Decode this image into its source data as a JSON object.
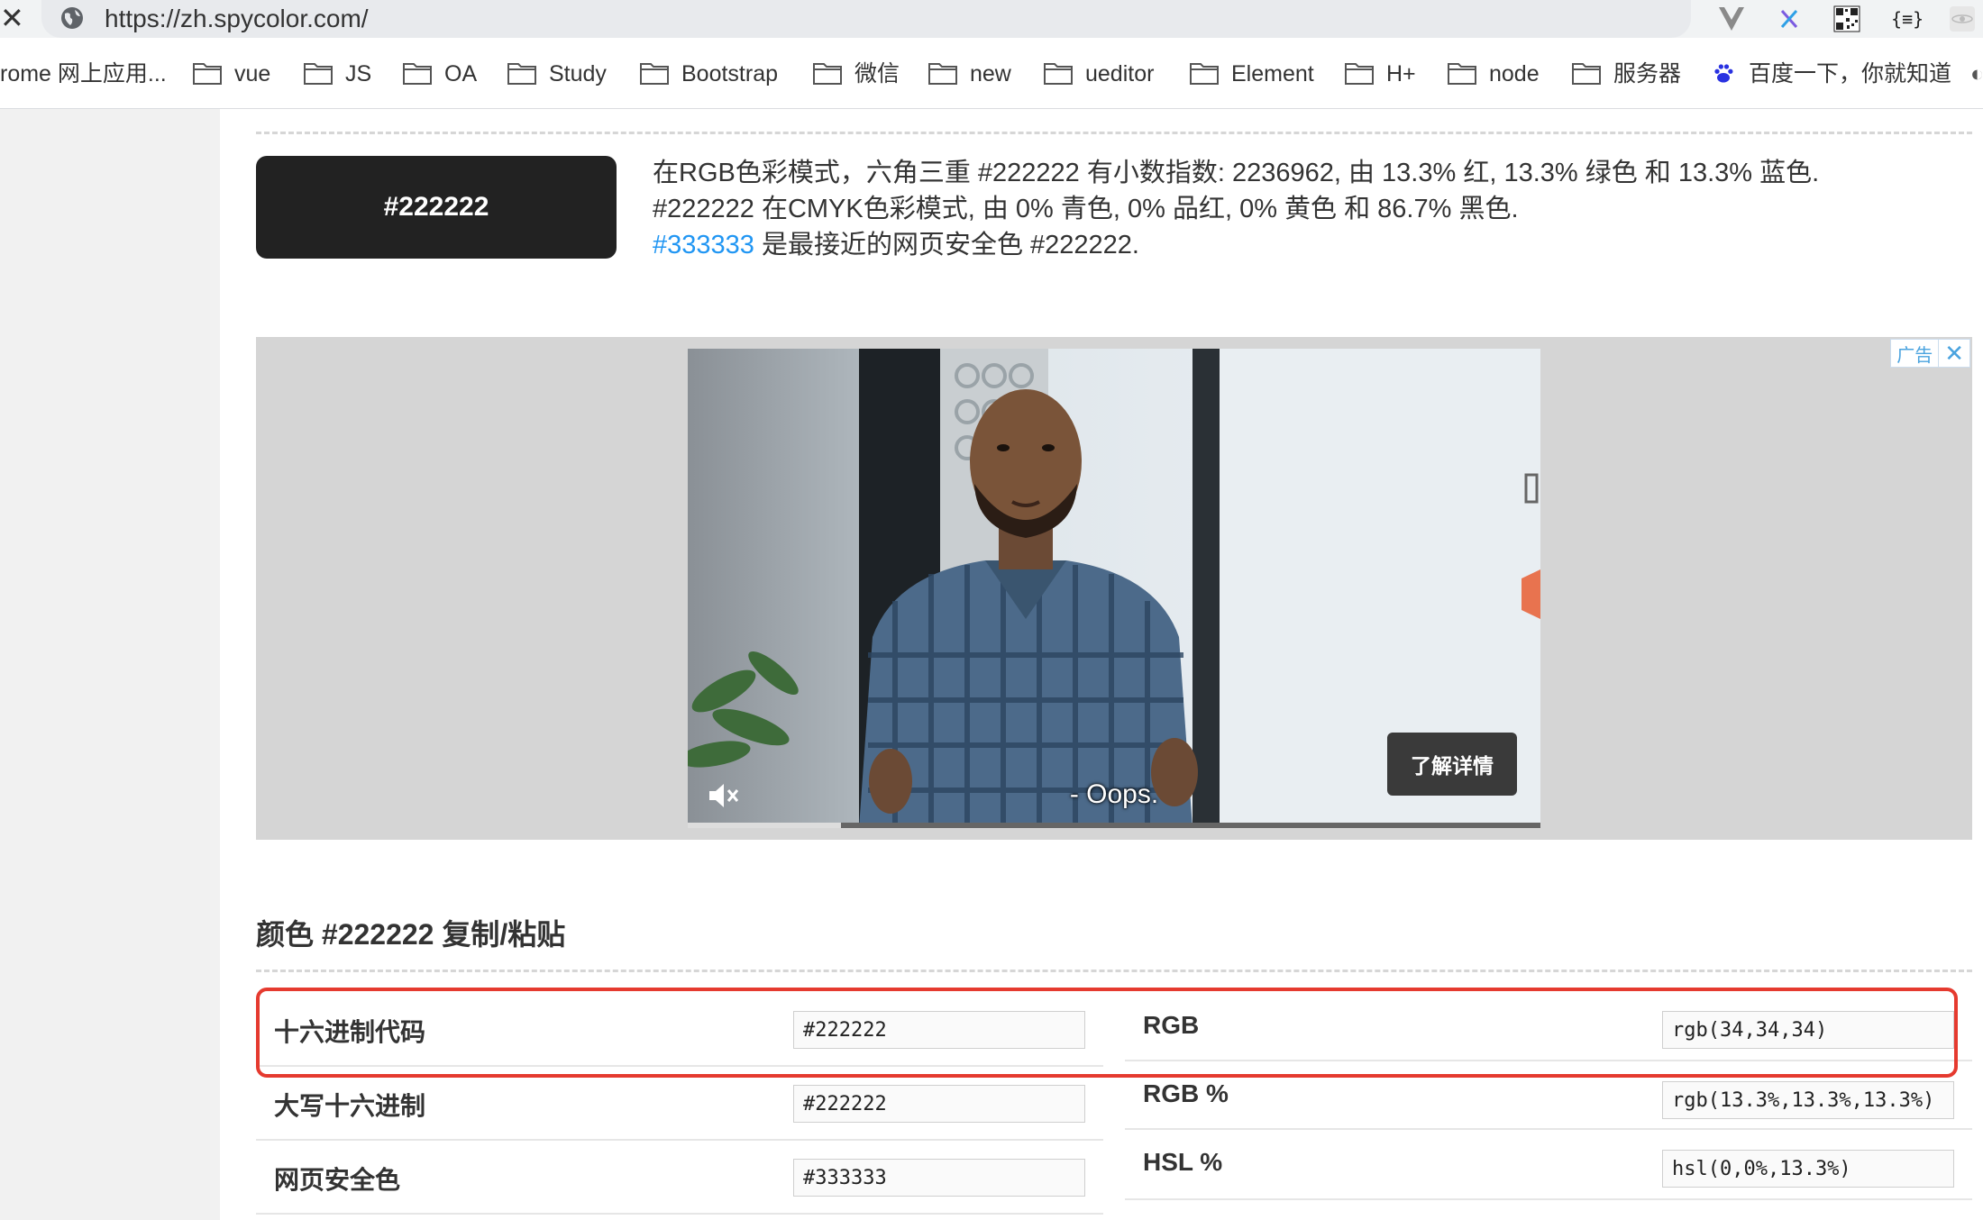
{
  "browser": {
    "url": "https://zh.spycolor.com/",
    "bookmarks": [
      "rome 网上应用...",
      "vue",
      "JS",
      "OA",
      "Study",
      "Bootstrap",
      "微信",
      "new",
      "ueditor",
      "Element",
      "H+",
      "node",
      "服务器",
      "百度一下，你就知道"
    ],
    "extensions": [
      "vue-devtools-icon",
      "x-extension-icon",
      "qr-code-icon",
      "json-viewer-icon",
      "react-devtools-icon"
    ],
    "json_ext_label": "{≡}"
  },
  "color_info": {
    "swatch_label": "#222222",
    "swatch_color": "#222222",
    "line1": "在RGB色彩模式，六角三重 #222222 有小数指数: 2236962, 由 13.3% 红, 13.3% 绿色 和 13.3% 蓝色.",
    "line2": "#222222 在CMYK色彩模式, 由 0% 青色, 0% 品红, 0% 黄色 和 86.7% 黑色.",
    "line3_link": "#333333",
    "line3_rest": " 是最接近的网页安全色 #222222."
  },
  "ad": {
    "label": "广告",
    "close": "✕",
    "learn_more": "了解详情",
    "subtitle": "- Oops.",
    "progress": 0.18
  },
  "copy_section": {
    "title": "颜色 #222222 复制/粘贴",
    "left_rows": [
      {
        "label": "十六进制代码",
        "value": "#222222"
      },
      {
        "label": "大写十六进制",
        "value": "#222222"
      },
      {
        "label": "网页安全色",
        "value": "#333333"
      }
    ],
    "right_rows": [
      {
        "label": "RGB",
        "value": "rgb(34,34,34)"
      },
      {
        "label": "RGB %",
        "value": "rgb(13.3%,13.3%,13.3%)"
      },
      {
        "label": "HSL %",
        "value": "hsl(0,0%,13.3%)"
      }
    ]
  },
  "colors": {
    "accent_link": "#2196f3",
    "highlight_border": "#e53a2f"
  }
}
